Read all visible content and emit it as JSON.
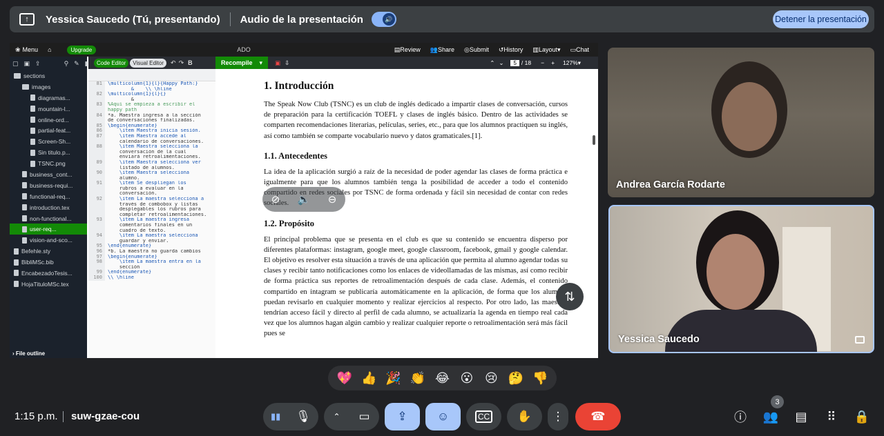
{
  "presenting_bar": {
    "presenter_label": "Yessica Saucedo (Tú, presentando)",
    "audio_label": "Audio de la presentación",
    "stop_button": "Detener la presentación"
  },
  "overleaf": {
    "topbar": {
      "menu": "Menu",
      "upgrade": "Upgrade",
      "project_name": "ADO",
      "review": "Review",
      "share": "Share",
      "submit": "Submit",
      "history": "History",
      "layout": "Layout",
      "chat": "Chat"
    },
    "file_tree": {
      "items": [
        {
          "label": "sections",
          "type": "folder",
          "level": 0
        },
        {
          "label": "images",
          "type": "folder",
          "level": 1
        },
        {
          "label": "diagramas...",
          "type": "file",
          "level": 2
        },
        {
          "label": "mountain-l...",
          "type": "file",
          "level": 2
        },
        {
          "label": "online-ord...",
          "type": "file",
          "level": 2
        },
        {
          "label": "partial-feat...",
          "type": "file",
          "level": 2
        },
        {
          "label": "Screen-Sh...",
          "type": "file",
          "level": 2
        },
        {
          "label": "Sin titulo.p...",
          "type": "file",
          "level": 2
        },
        {
          "label": "TSNC.png",
          "type": "file",
          "level": 2
        },
        {
          "label": "business_cont...",
          "type": "file",
          "level": 1
        },
        {
          "label": "business-requi...",
          "type": "file",
          "level": 1
        },
        {
          "label": "functional-req...",
          "type": "file",
          "level": 1
        },
        {
          "label": "introduction.tex",
          "type": "file",
          "level": 1
        },
        {
          "label": "non-functional...",
          "type": "file",
          "level": 1
        },
        {
          "label": "user-req...",
          "type": "file",
          "level": 1,
          "selected": true
        },
        {
          "label": "vision-and-sco...",
          "type": "file",
          "level": 1
        },
        {
          "label": "Befehle.sty",
          "type": "file",
          "level": 0
        },
        {
          "label": "BibliMSc.bib",
          "type": "file",
          "level": 0
        },
        {
          "label": "EncabezadoTesis...",
          "type": "file",
          "level": 0
        },
        {
          "label": "HojaTituloMSc.tex",
          "type": "file",
          "level": 0
        }
      ],
      "file_outline": "File outline"
    },
    "editor": {
      "code_editor_tab": "Code Editor",
      "visual_editor_tab": "Visual Editor",
      "lines": [
        {
          "n": "81",
          "t": "\\multicolumn{1}{l}{Happy Path:}"
        },
        {
          "n": "",
          "t": "        &    \\\\ \\hline"
        },
        {
          "n": "82",
          "t": "\\multicolumn{1}{l}{}"
        },
        {
          "n": "",
          "t": "        &"
        },
        {
          "n": "83",
          "t": "%Aquí se empieza a escribir el"
        },
        {
          "n": "",
          "t": "happy path"
        },
        {
          "n": "84",
          "t": "*a. Maestra ingresa a la sección"
        },
        {
          "n": "",
          "t": "de conversaciones finalizadas."
        },
        {
          "n": "85",
          "t": "\\begin{enumerate}"
        },
        {
          "n": "86",
          "t": "    \\item Maestra inicia sesión."
        },
        {
          "n": "87",
          "t": "    \\item Maestra accede al"
        },
        {
          "n": "",
          "t": "    calendario de conversaciones."
        },
        {
          "n": "88",
          "t": "    \\item Maestra selecciona la"
        },
        {
          "n": "",
          "t": "    conversación de la cual"
        },
        {
          "n": "",
          "t": "    enviará retroalimentaciones."
        },
        {
          "n": "89",
          "t": "    \\item Maestra selecciona ver"
        },
        {
          "n": "",
          "t": "    listado de alumnos."
        },
        {
          "n": "90",
          "t": "    \\item Maestra selecciona"
        },
        {
          "n": "",
          "t": "    alumno."
        },
        {
          "n": "91",
          "t": "    \\item Se despliegan los"
        },
        {
          "n": "",
          "t": "    rubros a evaluar en la"
        },
        {
          "n": "",
          "t": "    conversación."
        },
        {
          "n": "92",
          "t": "    \\item La maestra selecciona a"
        },
        {
          "n": "",
          "t": "    través de combobox y listas"
        },
        {
          "n": "",
          "t": "    desplegables los rubros para"
        },
        {
          "n": "",
          "t": "    completar retroalimentaciones."
        },
        {
          "n": "93",
          "t": "    \\item La maestra ingresa"
        },
        {
          "n": "",
          "t": "    comentarios finales en un"
        },
        {
          "n": "",
          "t": "    cuadro de texto."
        },
        {
          "n": "94",
          "t": "    \\item La maestra selecciona"
        },
        {
          "n": "",
          "t": "    guardar y enviar."
        },
        {
          "n": "95",
          "t": "\\end{enumerate}"
        },
        {
          "n": "96",
          "t": "*b. La maestra no guarda cambios"
        },
        {
          "n": "97",
          "t": "\\begin{enumerate}"
        },
        {
          "n": "98",
          "t": "    \\item La maestra entra en la"
        },
        {
          "n": "",
          "t": "    sección"
        },
        {
          "n": "99",
          "t": "\\end{enumerate}"
        },
        {
          "n": "100",
          "t": "\\\\ \\hline"
        }
      ]
    },
    "pdf_toolbar": {
      "recompile": "Recompile",
      "page_current": "5",
      "page_total": "/ 18",
      "zoom": "127%"
    },
    "pdf": {
      "h1": "1.   Introducción",
      "p1": "The Speak Now Club (TSNC) es un club de inglés dedicado a impartir clases de conversación, cursos de preparación para la certificación TOEFL y clases de inglés básico. Dentro de las actividades se comparten recomendaciones literarias, películas, series, etc., para que los alumnos practiquen su inglés, así como también se comparte vocabulario nuevo y datos gramaticales.[1].",
      "h2a": "1.1.    Antecedentes",
      "p2": "La idea de la aplicación surgió a raíz de la necesidad de poder agendar las clases de forma práctica e igualmente para que los alumnos también tenga la posibilidad de acceder a todo el contenido compartido en redes sociales por TSNC de forma ordenada y fácil sin necesidad de contar con redes sociales.",
      "h2b": "1.2.    Propósito",
      "p3": "El principal problema que se presenta en el club es que su contenido se encuentra disperso por diferentes plataformas: instagram, google meet, google classroom, facebook, gmail y google calendar. El objetivo es resolver esta situación a través de una aplicación que permita al alumno agendar todas su clases y recibir tanto notificaciones como los enlaces de videollamadas de las mismas, así como recibir de forma práctica sus reportes de retroalimentación después de cada clase. Además, el contenido compartido en intagram se publicaría automáticamente en la aplicación, de forma que los alumnos puedan revisarlo en cualquier momento y realizar ejercicios al respecto. Por otro lado, las maestras tendrían acceso fácil y directo al perfil de cada alumno, se actualizaría la agenda en tiempo real cada vez que los alumnos hagan algún cambio y realizar cualquier reporte o retroalimentación será más fácil pues se"
    }
  },
  "participants": [
    {
      "name": "Andrea García Rodarte"
    },
    {
      "name": "Yessica Saucedo"
    }
  ],
  "reactions": [
    "💖",
    "👍",
    "🎉",
    "👏",
    "😂",
    "😮",
    "😢",
    "🤔",
    "👎"
  ],
  "bottom_bar": {
    "time": "1:15 p.m.",
    "meeting_code": "suw-gzae-cou",
    "participant_count": "3"
  }
}
